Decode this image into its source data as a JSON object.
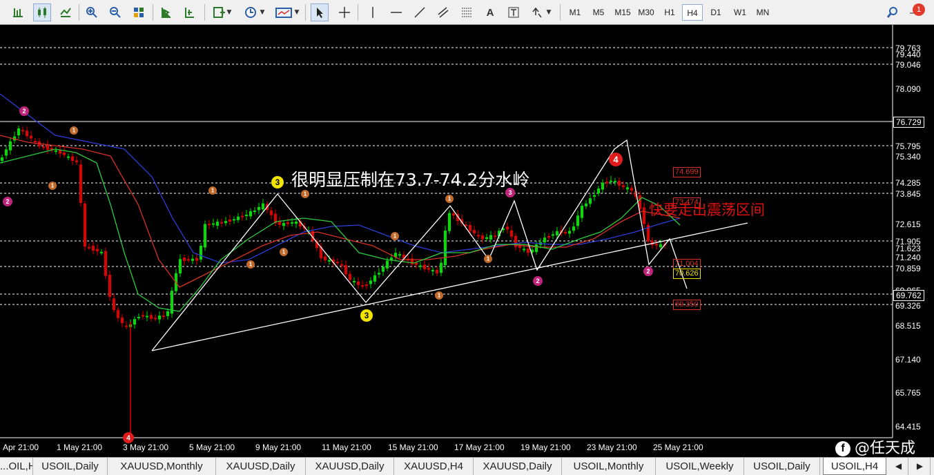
{
  "toolbar": {
    "icons": [
      "bar-chart-icon",
      "candlestick-icon",
      "line-chart-icon",
      "zoom-in-icon",
      "zoom-out-icon",
      "tile-windows-icon",
      "autoscroll-icon",
      "chart-shift-icon",
      "indicators-icon",
      "periods-icon",
      "templates-icon",
      "cursor-icon",
      "crosshair-icon",
      "vertical-line-icon",
      "horizontal-line-icon",
      "trendline-icon",
      "fibonacci-icon",
      "text-icon",
      "text-label-icon",
      "arrows-icon",
      "search-icon",
      "alerts-icon"
    ],
    "timeframes": [
      "M1",
      "M5",
      "M15",
      "M30",
      "H1",
      "H4",
      "D1",
      "W1",
      "MN"
    ],
    "active_timeframe": "H4",
    "alert_count": "1"
  },
  "chart": {
    "price_labels": {
      "p79763": "79.763",
      "p79440": "79.440",
      "p79046": "79.046",
      "p78090": "78.090",
      "p76729": "76.729",
      "p75795": "75.795",
      "p75340": "75.340",
      "p74285": "74.285",
      "p73845": "73.845",
      "p72615": "72.615",
      "p71905": "71.905",
      "p71623": "71.623",
      "p71240": "71.240",
      "p70859": "70.859",
      "p69965": "69.965",
      "p69762": "69.762",
      "p69326": "69.326",
      "p68515": "68.515",
      "p67140": "67.140",
      "p65765": "65.765",
      "p64415": "64.415"
    },
    "time_labels": {
      "t0": "Apr 21:00",
      "t1": "1 May 21:00",
      "t2": "3 May 21:00",
      "t3": "5 May 21:00",
      "t4": "9 May 21:00",
      "t5": "11 May 21:00",
      "t6": "15 May 21:00",
      "t7": "17 May 21:00",
      "t8": "19 May 21:00",
      "t9": "23 May 21:00",
      "t10": "25 May 21:00"
    },
    "order_levels": {
      "o1": "74.699",
      "o2": "73.474",
      "o3": "71.004",
      "o4": "70.626",
      "o5": "69.350"
    },
    "annotation_main": "很明显压制在73.7-74.2分水岭",
    "annotation_red": "快要走出震荡区间",
    "watermark": "@任天成",
    "watermark_logo": "f",
    "colors": {
      "bull": "#00e000",
      "bear": "#e00000",
      "ma_fast": "#2ecc40",
      "ma_mid": "#d93025",
      "ma_slow": "#2c3ed8",
      "level_line": "#ffffff",
      "wave_1": "#c26a2c",
      "wave_2": "#c0237a",
      "wave_3": "#f2e200",
      "wave_4": "#e01b1b"
    }
  },
  "tabs": [
    "...OIL,H4",
    "USOIL,Daily",
    "XAUUSD,Monthly",
    "XAUUSD,Daily",
    "XAUUSD,Daily",
    "XAUUSD,H4",
    "XAUUSD,Daily",
    "USOIL,Monthly",
    "USOIL,Weekly",
    "USOIL,Daily",
    "USOIL,H4"
  ],
  "active_tab": "USOIL,H4"
}
